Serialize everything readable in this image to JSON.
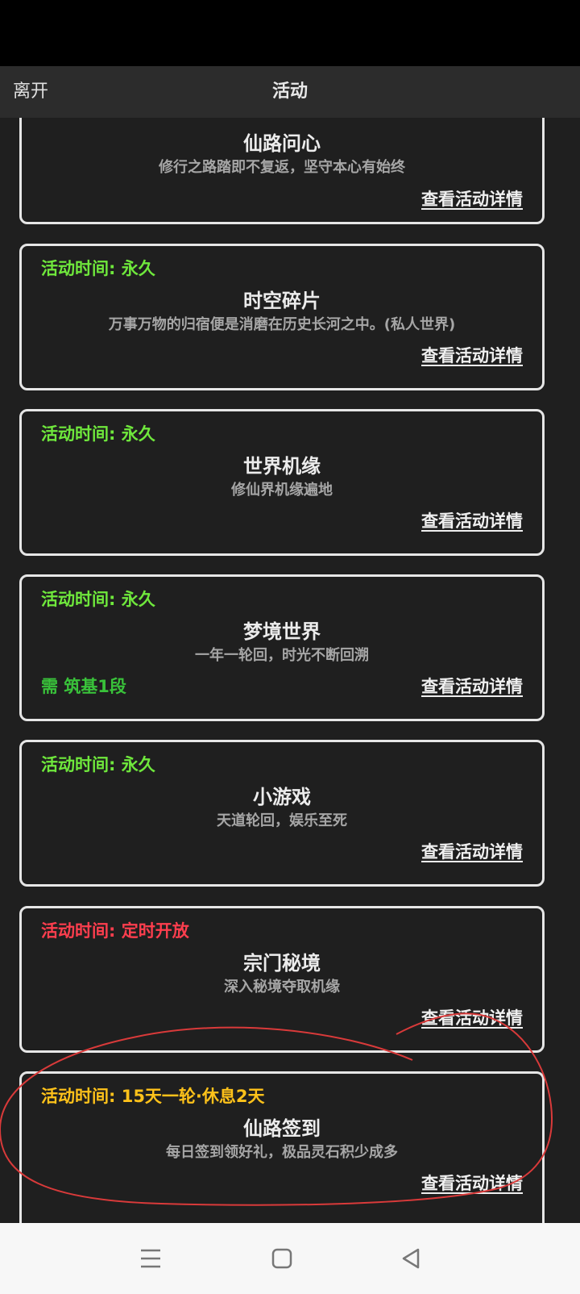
{
  "header": {
    "back_label": "离开",
    "title": "活动"
  },
  "cards": [
    {
      "name": "仙路问心",
      "desc": "修行之路踏即不复返，坚守本心有始终",
      "details": "查看活动详情"
    },
    {
      "time": "活动时间: 永久",
      "time_color": "#6fe83c",
      "name": "时空碎片",
      "desc": "万事万物的归宿便是消磨在历史长河之中。(私人世界)",
      "details": "查看活动详情"
    },
    {
      "time": "活动时间: 永久",
      "time_color": "#6fe83c",
      "name": "世界机缘",
      "desc": "修仙界机缘遍地",
      "details": "查看活动详情"
    },
    {
      "time": "活动时间: 永久",
      "time_color": "#6fe83c",
      "name": "梦境世界",
      "desc": "一年一轮回，时光不断回溯",
      "requirement": "需 筑基1段",
      "requirement_color": "#39c23a",
      "details": "查看活动详情"
    },
    {
      "time": "活动时间: 永久",
      "time_color": "#6fe83c",
      "name": "小游戏",
      "desc": "天道轮回，娱乐至死",
      "details": "查看活动详情"
    },
    {
      "time": "活动时间: 定时开放",
      "time_color": "#ff3e4e",
      "name": "宗门秘境",
      "desc": "深入秘境夺取机缘",
      "details": "查看活动详情"
    },
    {
      "time": "活动时间: 15天一轮·休息2天",
      "time_color": "#ffc21a",
      "name": "仙路签到",
      "desc": "每日签到领好礼，极品灵石积少成多",
      "details": "查看活动详情"
    }
  ],
  "annotation_color": "#d93a3a",
  "navbar": {
    "menu_icon": "menu-icon",
    "home_icon": "home-icon",
    "back_icon": "back-icon"
  }
}
